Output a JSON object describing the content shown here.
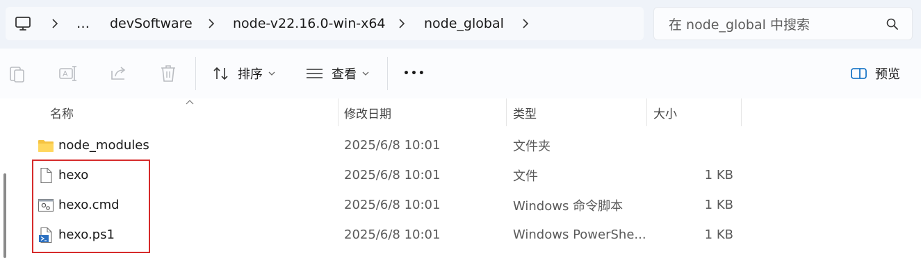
{
  "breadcrumb": {
    "items": [
      "…",
      "devSoftware",
      "node-v22.16.0-win-x64",
      "node_global"
    ]
  },
  "search": {
    "placeholder": "在 node_global 中搜索"
  },
  "toolbar": {
    "sort_label": "排序",
    "view_label": "查看",
    "more_label": "•••",
    "preview_label": "预览"
  },
  "columns": {
    "name": "名称",
    "date": "修改日期",
    "type": "类型",
    "size": "大小"
  },
  "files": [
    {
      "name": "node_modules",
      "date": "2025/6/8 10:01",
      "type": "文件夹",
      "size": "",
      "icon": "folder-icon"
    },
    {
      "name": "hexo",
      "date": "2025/6/8 10:01",
      "type": "文件",
      "size": "1 KB",
      "icon": "file-icon"
    },
    {
      "name": "hexo.cmd",
      "date": "2025/6/8 10:01",
      "type": "Windows 命令脚本",
      "size": "1 KB",
      "icon": "cmd-script-icon"
    },
    {
      "name": "hexo.ps1",
      "date": "2025/6/8 10:01",
      "type": "Windows PowerShe...",
      "size": "1 KB",
      "icon": "powershell-script-icon"
    }
  ],
  "colors": {
    "highlight": "#d62b2b",
    "topbar": "#eff3f9",
    "accent": "#0067c0"
  }
}
